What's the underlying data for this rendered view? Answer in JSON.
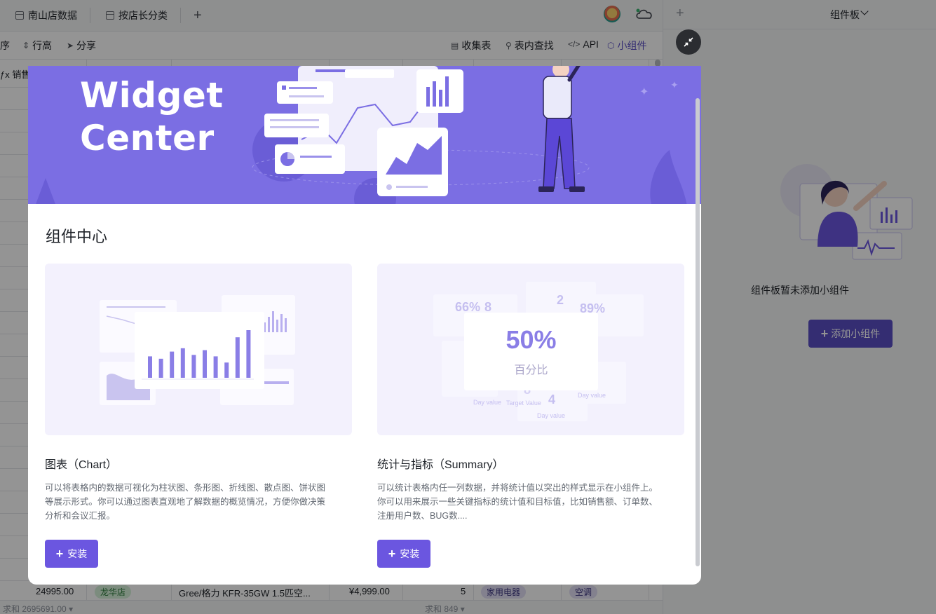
{
  "tabs": [
    {
      "label": "南山店数据"
    },
    {
      "label": "按店长分类"
    }
  ],
  "toolbar": {
    "sort": "序",
    "row_height": "行高",
    "share": "分享",
    "form": "收集表",
    "find": "表内查找",
    "api": "API",
    "widget": "小组件"
  },
  "grid": {
    "header_label": "销售额",
    "last_row": {
      "amount": "24995.00",
      "store": "龙华店",
      "product": "Gree/格力 KFR-35GW 1.5匹空...",
      "price": "¥4,999.00",
      "qty": "5",
      "category": "家用电器",
      "subcategory": "空调"
    },
    "footer_sum_left": "求和 2695691.00",
    "footer_sum_right": "求和 849"
  },
  "sidebar": {
    "title": "组件板",
    "empty_text": "组件板暂未添加小组件",
    "add_button": "添加小组件"
  },
  "modal": {
    "banner_title_line1": "Widget",
    "banner_title_line2": "Center",
    "title": "组件中心",
    "cards": [
      {
        "name": "图表（Chart）",
        "description": "可以将表格内的数据可视化为柱状图、条形图、折线图、散点图、饼状图等展示形式。你可以通过图表直观地了解数据的概览情况，方便你做决策分析和会议汇报。",
        "install_label": "安装",
        "bar_values": [
          45,
          40,
          55,
          62,
          48,
          58,
          45,
          32,
          85,
          100
        ]
      },
      {
        "name": "统计与指标（Summary）",
        "description": "可以统计表格内任一列数据，并将统计值以突出的样式显示在小组件上。你可以用来展示一些关键指标的统计值和目标值，比如销售额、订单数、注册用户数、BUG数....",
        "install_label": "安装",
        "main_value": "50%",
        "main_label": "百分比",
        "bg_values": [
          "66%",
          "8",
          "2",
          "89%",
          "8",
          "4"
        ],
        "bg_labels": [
          "Day value",
          "Target Value",
          "Day value",
          "Day value"
        ]
      }
    ]
  },
  "colors": {
    "accent": "#6b56e0",
    "banner": "#7b6ee3",
    "sidebar_button": "#5b4fc4"
  }
}
